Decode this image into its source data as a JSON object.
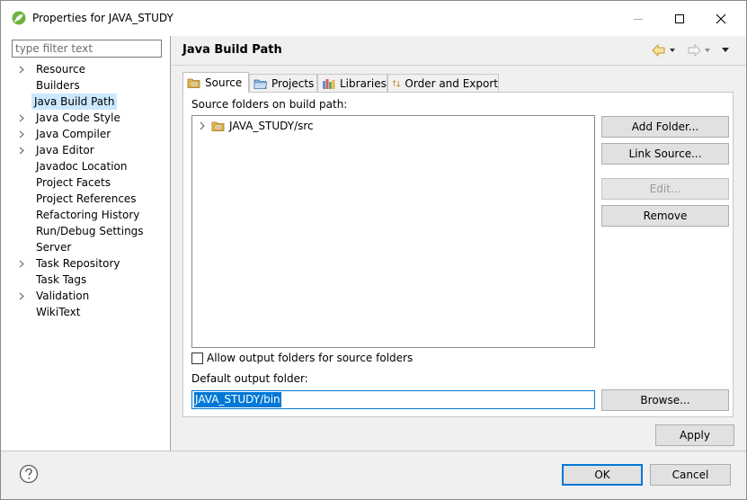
{
  "window": {
    "title": "Properties for JAVA_STUDY"
  },
  "sidebar": {
    "filter_placeholder": "type filter text",
    "items": [
      {
        "label": "Resource",
        "expandable": true
      },
      {
        "label": "Builders",
        "expandable": false
      },
      {
        "label": "Java Build Path",
        "expandable": false,
        "selected": true
      },
      {
        "label": "Java Code Style",
        "expandable": true
      },
      {
        "label": "Java Compiler",
        "expandable": true
      },
      {
        "label": "Java Editor",
        "expandable": true
      },
      {
        "label": "Javadoc Location",
        "expandable": false
      },
      {
        "label": "Project Facets",
        "expandable": false
      },
      {
        "label": "Project References",
        "expandable": false
      },
      {
        "label": "Refactoring History",
        "expandable": false
      },
      {
        "label": "Run/Debug Settings",
        "expandable": false
      },
      {
        "label": "Server",
        "expandable": false
      },
      {
        "label": "Task Repository",
        "expandable": true
      },
      {
        "label": "Task Tags",
        "expandable": false
      },
      {
        "label": "Validation",
        "expandable": true
      },
      {
        "label": "WikiText",
        "expandable": false
      }
    ]
  },
  "main": {
    "title": "Java Build Path",
    "tabs": [
      {
        "label": "Source",
        "active": true,
        "icon": "source-folder-icon"
      },
      {
        "label": "Projects",
        "active": false,
        "icon": "projects-folder-icon"
      },
      {
        "label": "Libraries",
        "active": false,
        "icon": "libraries-icon"
      },
      {
        "label": "Order and Export",
        "active": false,
        "icon": "order-export-icon"
      }
    ],
    "source_label": "Source folders on build path:",
    "source_folders": [
      "JAVA_STUDY/src"
    ],
    "buttons": {
      "add_folder": "Add Folder...",
      "link_source": "Link Source...",
      "edit": "Edit...",
      "remove": "Remove"
    },
    "allow_output_label": "Allow output folders for source folders",
    "allow_output_checked": false,
    "default_output_label": "Default output folder:",
    "default_output_value": "JAVA_STUDY/bin",
    "browse": "Browse...",
    "apply": "Apply"
  },
  "footer": {
    "ok": "OK",
    "cancel": "Cancel"
  },
  "colors": {
    "accent": "#0078d7",
    "selection": "#cce8ff",
    "folder": "#e8b64b"
  }
}
